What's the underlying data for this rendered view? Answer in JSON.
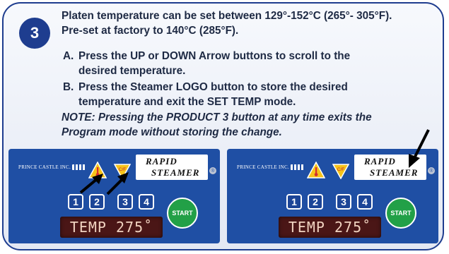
{
  "step_number": "3",
  "intro_lines": [
    "Platen temperature can be set between 129°-152°C (265°- 305°F).",
    "Pre-set at factory to 140°C (285°F)."
  ],
  "steps": [
    {
      "key": "A.",
      "lines": [
        "Press the UP or DOWN Arrow buttons to scroll to the",
        "desired temperature."
      ]
    },
    {
      "key": "B.",
      "lines": [
        "Press the Steamer LOGO button to store the desired",
        "temperature and exit the SET TEMP mode."
      ]
    }
  ],
  "note_lines": [
    "NOTE: Pressing the PRODUCT 3 button at any time exits the",
    "Program mode without storing the change."
  ],
  "panel": {
    "brand_text": "PRINCE CASTLE INC.",
    "cf_label": "C/F",
    "logo_line1": "RAPID",
    "logo_line2": "STEAMER",
    "registered": "®",
    "product_buttons": [
      "1",
      "2",
      "3",
      "4"
    ],
    "display_text": "TEMP 275˚",
    "start_label": "START"
  },
  "colors": {
    "panel_blue": "#1f4fa4",
    "border_navy": "#1e3d8f",
    "warn_yellow": "#f6c31a",
    "start_green": "#22a047",
    "display_bg": "#4a1616"
  },
  "icons": [
    "warning-thermometer-icon",
    "cf-toggle-icon",
    "pointer-arrow-icon"
  ]
}
